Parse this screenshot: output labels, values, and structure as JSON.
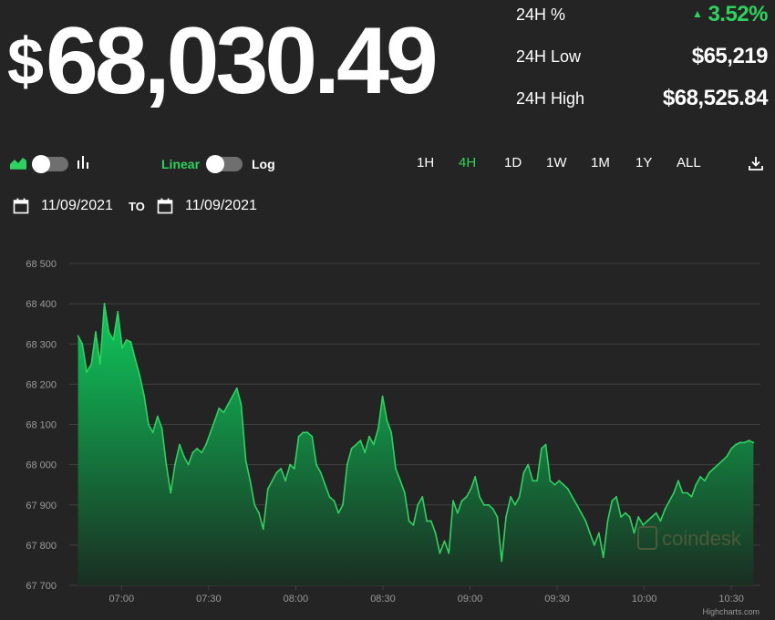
{
  "price": {
    "currency": "$",
    "value": "68,030.49"
  },
  "stats": {
    "pct_label": "24H %",
    "pct_value": "3.52%",
    "low_label": "24H Low",
    "low_value": "$65,219",
    "high_label": "24H High",
    "high_value": "$68,525.84",
    "up_color": "#2ed35f"
  },
  "controls": {
    "linear_label": "Linear",
    "log_label": "Log",
    "ranges": [
      "1H",
      "4H",
      "1D",
      "1W",
      "1M",
      "1Y",
      "ALL"
    ],
    "active_range": "4H"
  },
  "dates": {
    "from": "11/09/2021",
    "to_label": "TO",
    "to": "11/09/2021"
  },
  "watermark": "coindesk",
  "credits": "Highcharts.com",
  "chart_data": {
    "type": "area",
    "ylim": [
      67700,
      68500
    ],
    "yticks": [
      67700,
      67800,
      67900,
      68000,
      68100,
      68200,
      68300,
      68400,
      68500
    ],
    "ytick_labels": [
      "67 700",
      "67 800",
      "67 900",
      "68 000",
      "68 100",
      "68 200",
      "68 300",
      "68 400",
      "68 500"
    ],
    "xlim_minutes": [
      402,
      640
    ],
    "xticks": [
      420,
      450,
      480,
      510,
      540,
      570,
      600,
      630
    ],
    "xtick_labels": [
      "07:00",
      "07:30",
      "08:00",
      "08:30",
      "09:00",
      "09:30",
      "10:00",
      "10:30"
    ],
    "line_color": "#2ed35f",
    "grid": true,
    "series": [
      {
        "x": [
          405.0,
          406.5,
          408.0,
          409.6,
          411.1,
          412.6,
          414.1,
          415.6,
          417.2,
          418.7,
          420.2,
          421.7,
          423.2,
          424.8,
          426.3,
          427.8,
          429.3,
          430.8,
          432.4,
          433.9,
          435.4,
          436.9,
          438.4,
          440.0,
          441.5,
          443.0,
          444.5,
          446.0,
          447.6,
          449.1,
          450.6,
          452.1,
          453.6,
          455.2,
          456.7,
          458.2,
          459.7,
          461.2,
          462.8,
          464.3,
          465.8,
          467.3,
          468.8,
          470.4,
          471.9,
          473.4,
          474.9,
          476.4,
          478.0,
          479.5,
          481.0,
          482.5,
          484.0,
          485.6,
          487.1,
          488.6,
          490.1,
          491.6,
          493.2,
          494.7,
          496.2,
          497.7,
          499.2,
          500.8,
          502.3,
          503.8,
          505.3,
          506.8,
          508.4,
          509.9,
          511.4,
          512.9,
          514.4,
          516.0,
          517.5,
          519.0,
          520.5,
          522.0,
          523.6,
          525.1,
          526.6,
          528.1,
          529.6,
          531.2,
          532.7,
          534.2,
          535.7,
          537.2,
          538.8,
          540.3,
          541.8,
          543.3,
          544.8,
          546.4,
          547.9,
          549.4,
          550.9,
          552.4,
          554.0,
          555.5,
          557.0,
          558.5,
          560.0,
          561.6,
          563.1,
          564.6,
          566.1,
          567.6,
          569.2,
          570.7,
          572.2,
          573.7,
          575.2,
          576.8,
          578.3,
          579.8,
          581.3,
          582.8,
          584.4,
          585.9,
          587.4,
          588.9,
          590.4,
          592.0,
          593.5,
          595.0,
          596.5,
          598.0,
          599.6,
          601.1,
          602.6,
          604.1,
          605.6,
          607.2,
          608.7,
          610.2,
          611.7,
          613.2,
          614.8,
          616.3,
          617.8,
          619.3,
          620.8,
          622.4,
          623.9,
          625.4,
          626.9,
          628.4,
          630.0,
          631.5,
          633.0,
          634.5,
          636.0,
          637.6
        ],
        "y": [
          68320,
          68300,
          68230,
          68250,
          68330,
          68250,
          68400,
          68330,
          68310,
          68380,
          68290,
          68310,
          68305,
          68260,
          68220,
          68170,
          68100,
          68080,
          68120,
          68090,
          68000,
          67930,
          68000,
          68050,
          68020,
          68000,
          68030,
          68040,
          68030,
          68050,
          68080,
          68110,
          68140,
          68130,
          68150,
          68170,
          68190,
          68150,
          68010,
          67960,
          67900,
          67880,
          67840,
          67940,
          67960,
          67980,
          67990,
          67960,
          68000,
          67990,
          68070,
          68080,
          68080,
          68070,
          68000,
          67980,
          67950,
          67920,
          67910,
          67880,
          67900,
          68000,
          68040,
          68050,
          68060,
          68030,
          68070,
          68050,
          68090,
          68170,
          68110,
          68080,
          67990,
          67960,
          67930,
          67860,
          67850,
          67900,
          67920,
          67860,
          67860,
          67830,
          67780,
          67810,
          67780,
          67910,
          67880,
          67910,
          67920,
          67940,
          67970,
          67920,
          67900,
          67900,
          67890,
          67870,
          67760,
          67870,
          67920,
          67900,
          67920,
          67980,
          68000,
          67960,
          67960,
          68040,
          68050,
          67960,
          67950,
          67960,
          67950,
          67940,
          67920,
          67900,
          67880,
          67860,
          67830,
          67800,
          67830,
          67770,
          67860,
          67910,
          67920,
          67870,
          67880,
          67870,
          67830,
          67870,
          67850,
          67860,
          67870,
          67880,
          67860,
          67890,
          67910,
          67930,
          67960,
          67930,
          67930,
          67920,
          67950,
          67970,
          67960,
          67980,
          67990,
          68000,
          68010,
          68020,
          68040,
          68050,
          68055,
          68055,
          68060,
          68055
        ]
      }
    ]
  }
}
